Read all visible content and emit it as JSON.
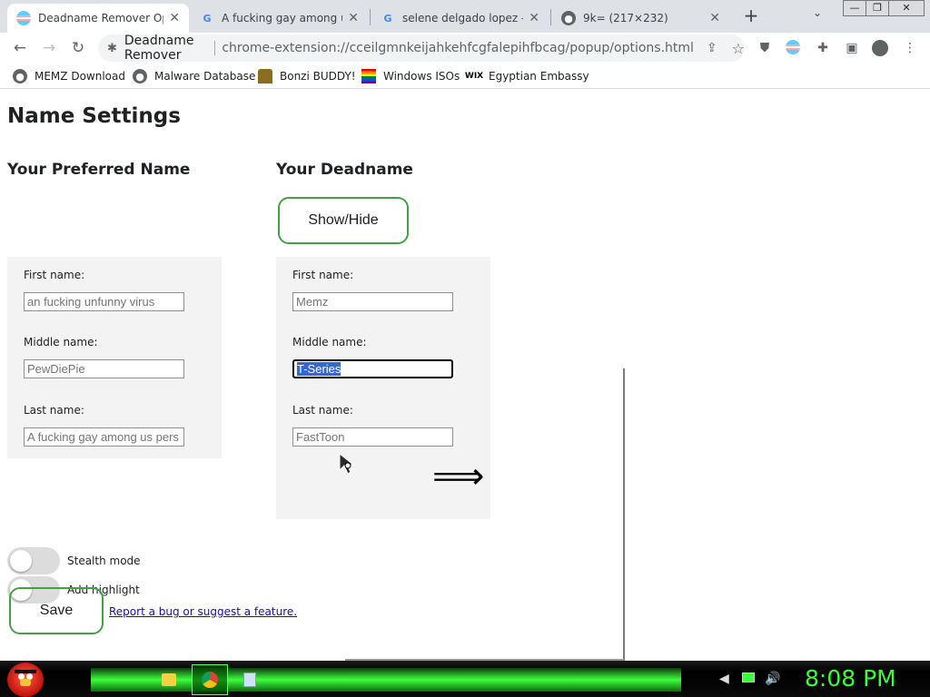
{
  "browser": {
    "tabs": [
      {
        "title": "Deadname Remover Opti",
        "active": true
      },
      {
        "title": "A fucking gay among us",
        "active": false
      },
      {
        "title": "selene delgado lopez - G",
        "active": false
      },
      {
        "title": "9k= (217×232)",
        "active": false
      }
    ],
    "window_controls": {
      "min": "—",
      "max": "❐",
      "close": "✕"
    },
    "omnibox": {
      "site_name": "Deadname Remover",
      "url": "chrome-extension://cceilgmnkeijahkehfcgfalepihfbcag/popup/options.html"
    },
    "bookmarks": [
      {
        "label": "MEMZ Download",
        "icon": "globe-icon"
      },
      {
        "label": "Malware Database",
        "icon": "globe-icon"
      },
      {
        "label": "Bonzi BUDDY!",
        "icon": "bonzi-icon"
      },
      {
        "label": "Windows ISOs",
        "icon": "rainbow-flag-icon"
      },
      {
        "label": "Egyptian Embassy",
        "icon": "wix-icon"
      }
    ]
  },
  "page": {
    "title": "Name Settings",
    "preferred": {
      "heading": "Your Preferred Name",
      "first_label": "First name:",
      "first_placeholder": "an fucking unfunny virus",
      "middle_label": "Middle name:",
      "middle_placeholder": "PewDiePie",
      "last_label": "Last name:",
      "last_placeholder": "A fucking gay among us pers"
    },
    "deadname": {
      "heading": "Your Deadname",
      "toggle_label": "Show/Hide",
      "first_label": "First name:",
      "first_placeholder": "Memz",
      "middle_label": "Middle name:",
      "middle_value": "T-Series",
      "last_label": "Last name:",
      "last_placeholder": "FastToon",
      "arrow": "⟹"
    },
    "options": {
      "stealth_label": "Stealth mode",
      "stealth_on": false,
      "highlight_label": "Add highlight",
      "highlight_on": false
    },
    "save_label": "Save",
    "report_link": "Report a bug or suggest a feature."
  },
  "taskbar": {
    "clock": "8:08 PM"
  },
  "colors": {
    "accent_green": "#43a047",
    "selection_blue": "#3367d6",
    "clock_green": "#3cff3c"
  }
}
